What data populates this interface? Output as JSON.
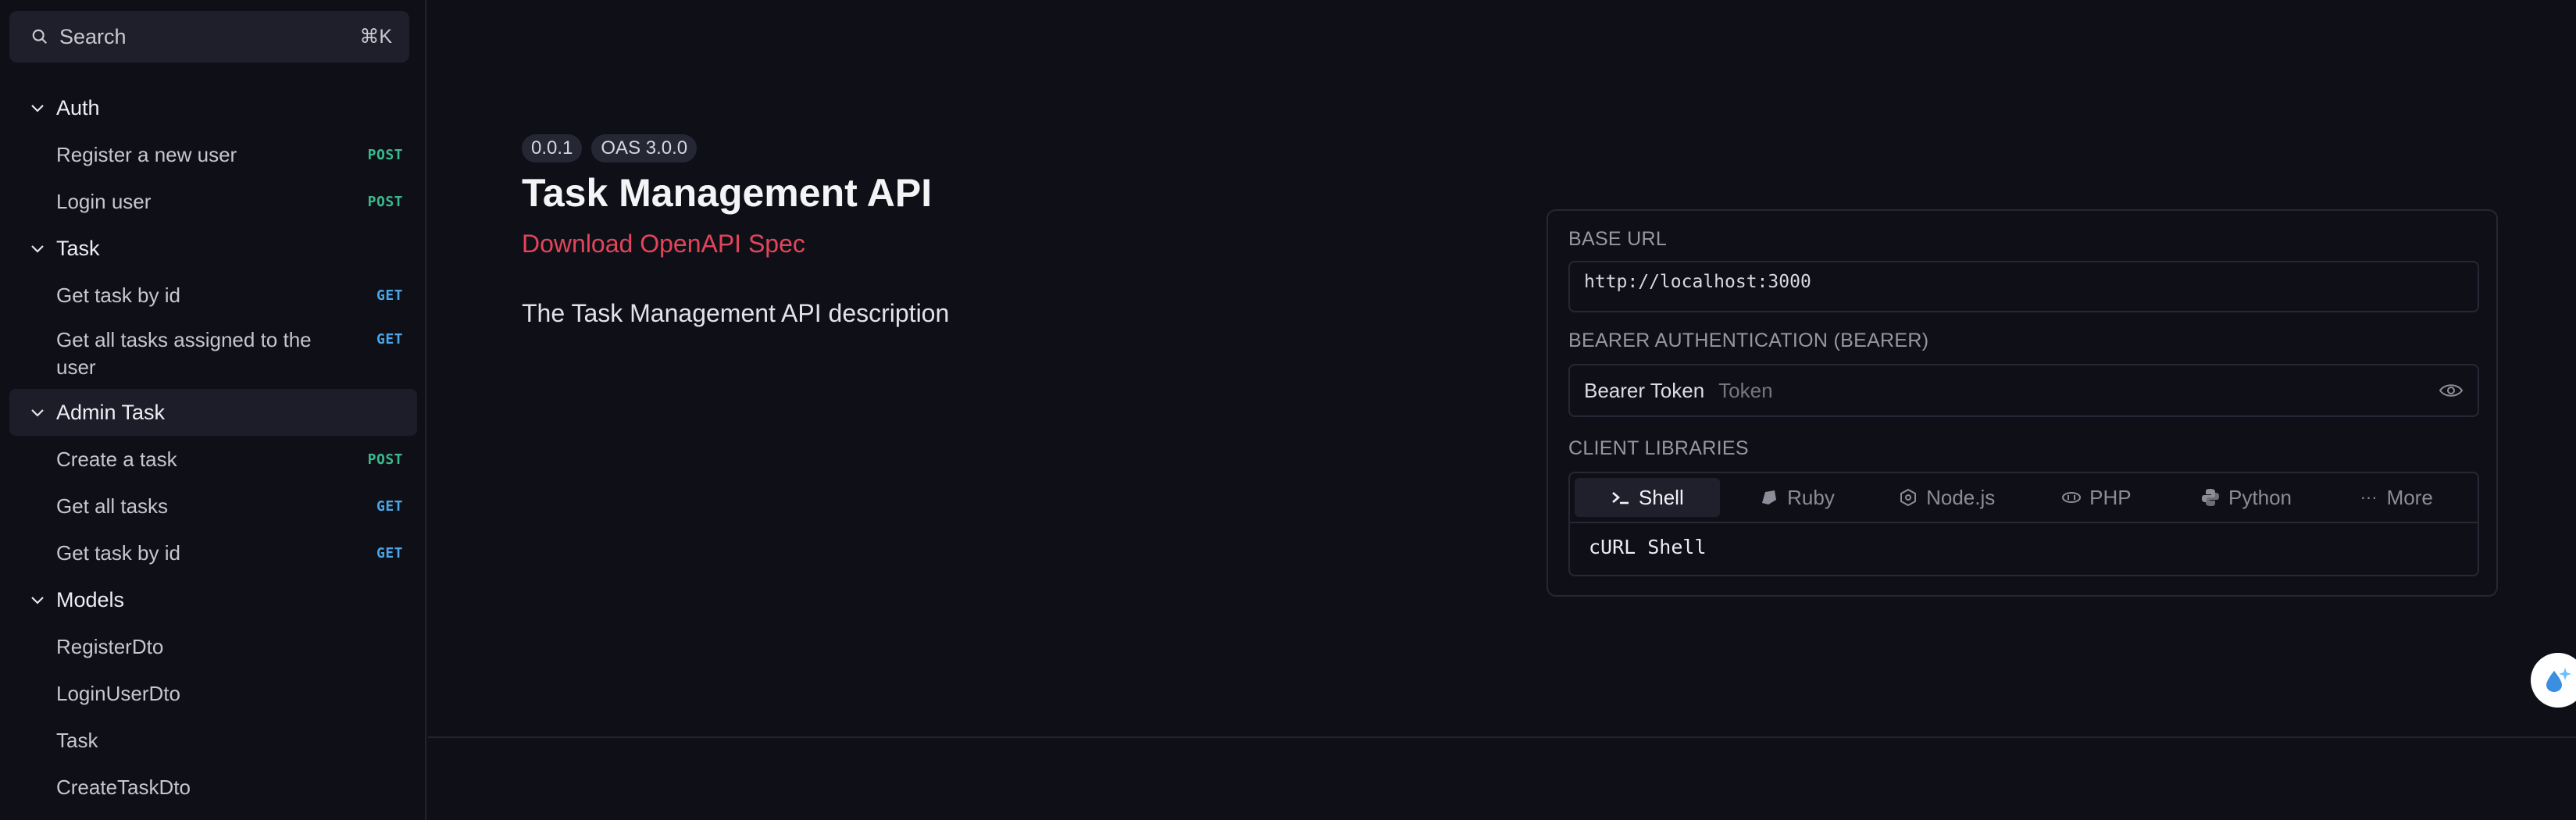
{
  "sidebar": {
    "search": {
      "label": "Search",
      "shortcut": "⌘K"
    },
    "groups": [
      {
        "name": "Auth",
        "items": [
          {
            "label": "Register a new user",
            "method": "POST"
          },
          {
            "label": "Login user",
            "method": "POST"
          }
        ]
      },
      {
        "name": "Task",
        "items": [
          {
            "label": "Get task by id",
            "method": "GET"
          },
          {
            "label": "Get all tasks assigned to the user",
            "method": "GET"
          }
        ]
      },
      {
        "name": "Admin Task",
        "items": [
          {
            "label": "Create a task",
            "method": "POST"
          },
          {
            "label": "Get all tasks",
            "method": "GET"
          },
          {
            "label": "Get task by id",
            "method": "GET"
          }
        ]
      },
      {
        "name": "Models",
        "items": [
          {
            "label": "RegisterDto"
          },
          {
            "label": "LoginUserDto"
          },
          {
            "label": "Task"
          },
          {
            "label": "CreateTaskDto"
          }
        ]
      }
    ]
  },
  "main": {
    "badges": {
      "version": "0.0.1",
      "oas": "OAS 3.0.0"
    },
    "title": "Task Management API",
    "download": "Download OpenAPI Spec",
    "description": "The Task Management API description"
  },
  "panel": {
    "base_url_label": "BASE URL",
    "base_url": "http://localhost:3000",
    "auth_label": "BEARER AUTHENTICATION (BEARER)",
    "token_label": "Bearer Token",
    "token_placeholder": "Token",
    "libs_label": "CLIENT LIBRARIES",
    "tabs": [
      "Shell",
      "Ruby",
      "Node.js",
      "PHP",
      "Python",
      "More"
    ],
    "code": "cURL Shell"
  },
  "colors": {
    "post": "#3ab98f",
    "get": "#4aa6e8",
    "link": "#e2455a"
  }
}
